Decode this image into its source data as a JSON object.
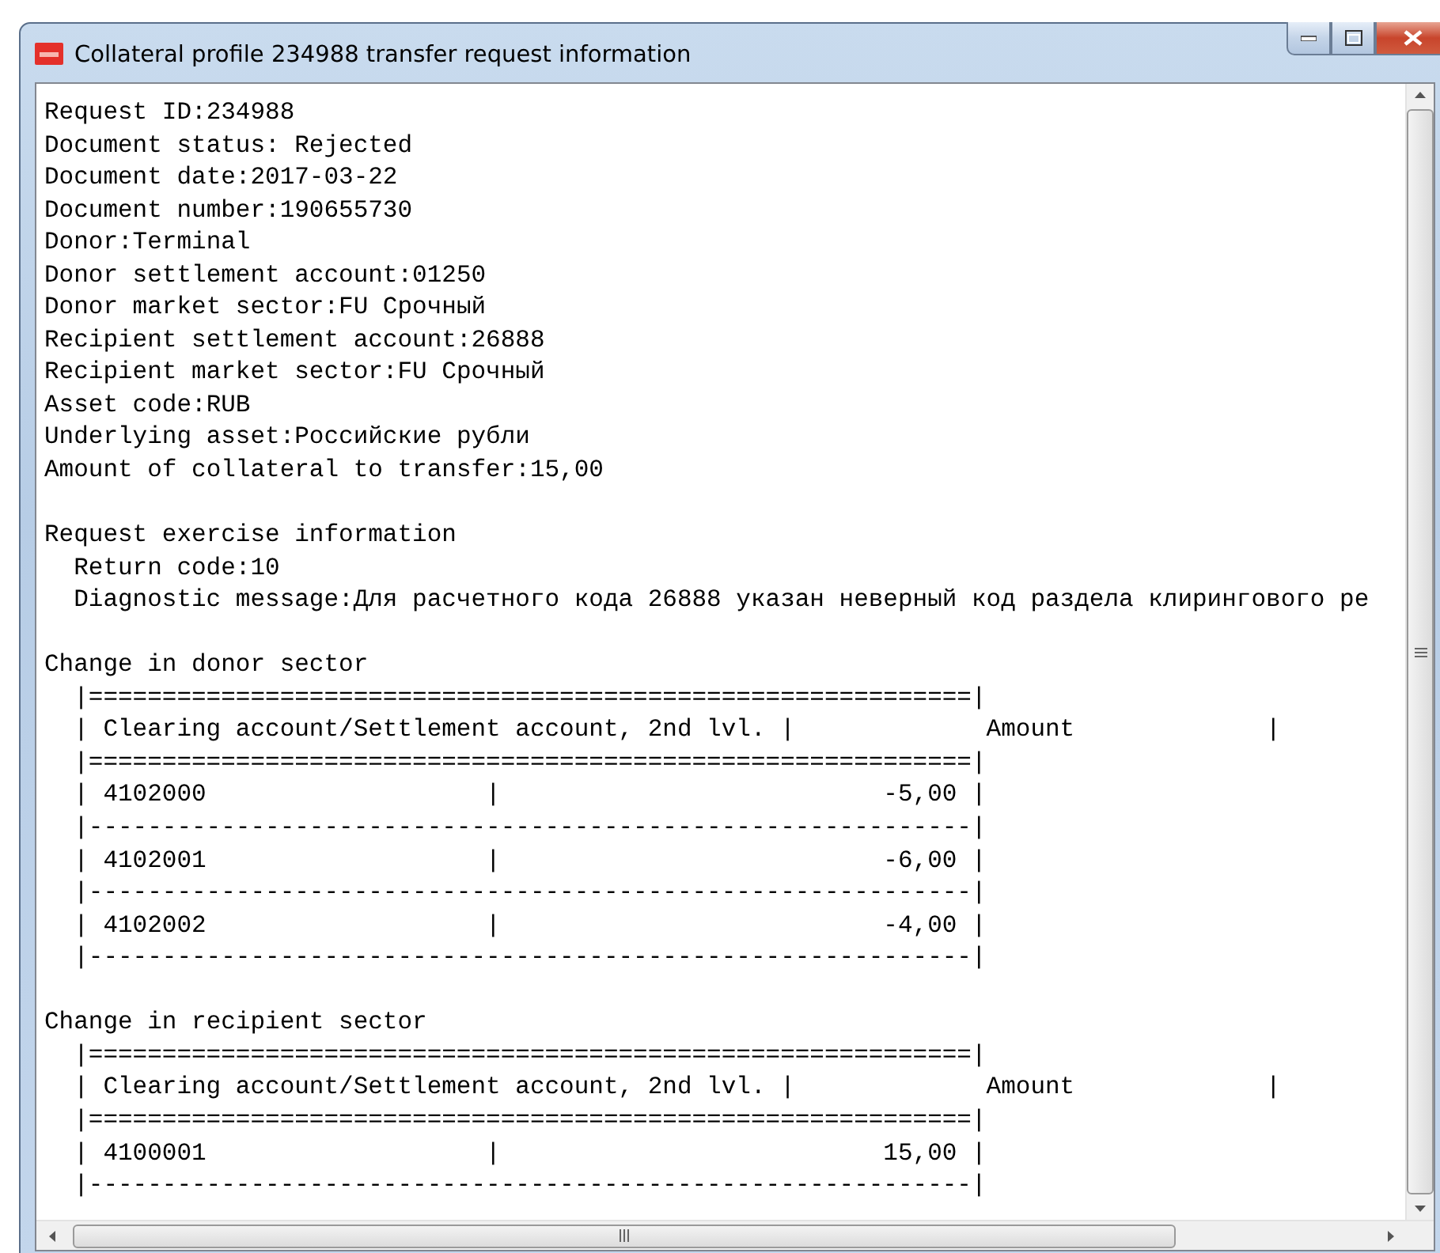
{
  "window": {
    "title": "Collateral profile 234988 transfer request information"
  },
  "lines": [
    {
      "kind": "text",
      "text": "Request ID:234988"
    },
    {
      "kind": "text",
      "text": "Document status: Rejected"
    },
    {
      "kind": "text",
      "text": "Document date:2017-03-22"
    },
    {
      "kind": "text",
      "text": "Document number:190655730"
    },
    {
      "kind": "text",
      "text": "Donor:Terminal"
    },
    {
      "kind": "text",
      "text": "Donor settlement account:01250"
    },
    {
      "kind": "text",
      "text": "Donor market sector:FU Срочный"
    },
    {
      "kind": "text",
      "text": "Recipient settlement account:26888"
    },
    {
      "kind": "text",
      "text": "Recipient market sector:FU Срочный"
    },
    {
      "kind": "text",
      "text": "Asset code:RUB"
    },
    {
      "kind": "text",
      "text": "Underlying asset:Российские рубли"
    },
    {
      "kind": "text",
      "text": "Amount of collateral to transfer:15,00"
    },
    {
      "kind": "gap"
    },
    {
      "kind": "text",
      "text": "Request exercise information"
    },
    {
      "kind": "indented",
      "text": "Return code:10"
    },
    {
      "kind": "indented",
      "text": "Diagnostic message:Для расчетного кода 26888 указан неверный код раздела клирингового ре"
    },
    {
      "kind": "gap"
    },
    {
      "kind": "text",
      "text": "Change in donor sector"
    },
    {
      "kind": "indented",
      "text": "|============================================================|"
    },
    {
      "kind": "indented",
      "text": "| Clearing account/Settlement account, 2nd lvl. |             Amount             |"
    },
    {
      "kind": "indented",
      "text": "|============================================================|"
    },
    {
      "kind": "indented",
      "text": "| 4102000                   |                          -5,00 |"
    },
    {
      "kind": "indented",
      "text": "|------------------------------------------------------------|"
    },
    {
      "kind": "indented",
      "text": "| 4102001                   |                          -6,00 |"
    },
    {
      "kind": "indented",
      "text": "|------------------------------------------------------------|"
    },
    {
      "kind": "indented",
      "text": "| 4102002                   |                          -4,00 |"
    },
    {
      "kind": "indented",
      "text": "|------------------------------------------------------------|"
    },
    {
      "kind": "gap"
    },
    {
      "kind": "text",
      "text": "Change in recipient sector"
    },
    {
      "kind": "indented",
      "text": "|============================================================|"
    },
    {
      "kind": "indented",
      "text": "| Clearing account/Settlement account, 2nd lvl. |             Amount             |"
    },
    {
      "kind": "indented",
      "text": "|============================================================|"
    },
    {
      "kind": "indented",
      "text": "| 4100001                   |                          15,00 |"
    },
    {
      "kind": "indented",
      "text": "|------------------------------------------------------------|"
    }
  ]
}
